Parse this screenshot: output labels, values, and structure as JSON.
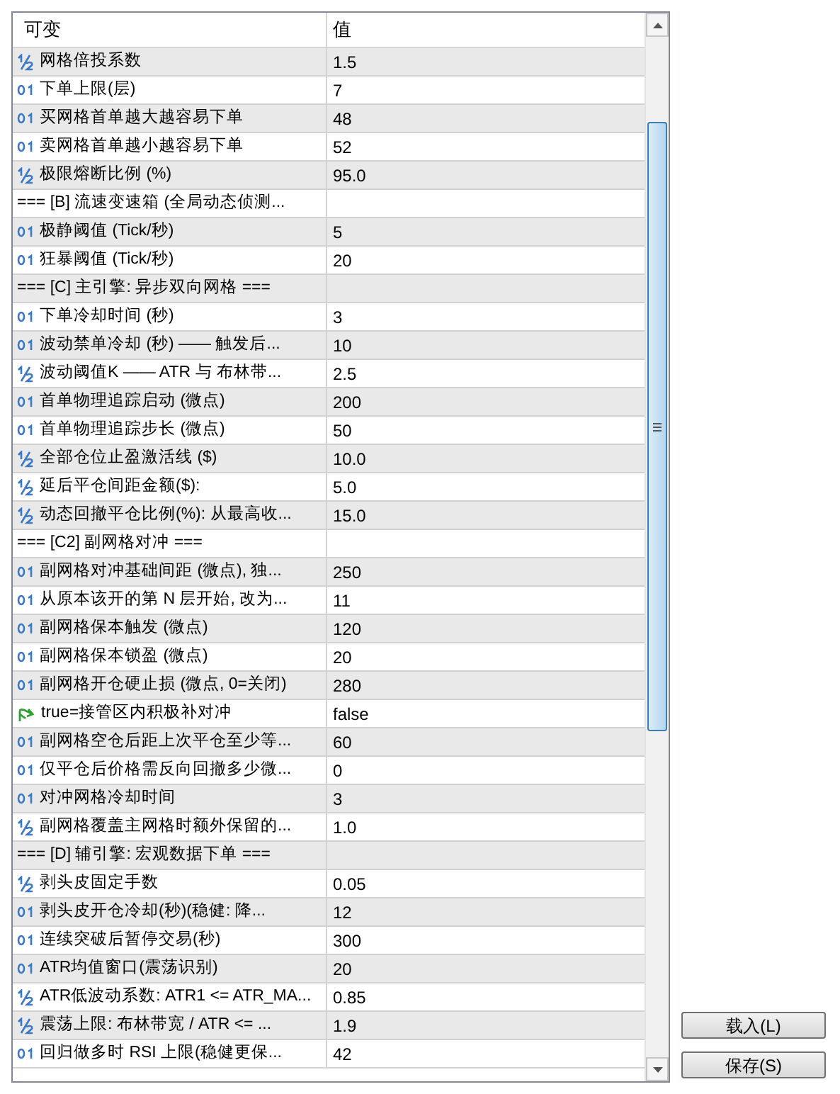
{
  "table": {
    "columns": [
      "可变",
      "值"
    ],
    "rows": [
      {
        "kind": "double",
        "name": "网格倍投系数",
        "value": "1.5"
      },
      {
        "kind": "int",
        "name": "下单上限(层)",
        "value": "7"
      },
      {
        "kind": "int",
        "name": "买网格首单越大越容易下单",
        "value": "48"
      },
      {
        "kind": "int",
        "name": "卖网格首单越小越容易下单",
        "value": "52"
      },
      {
        "kind": "double",
        "name": "极限熔断比例 (%)",
        "value": "95.0"
      },
      {
        "kind": "header",
        "name": "=== [B] 流速变速箱 (全局动态侦测..."
      },
      {
        "kind": "int",
        "name": "极静阈值 (Tick/秒)",
        "value": "5"
      },
      {
        "kind": "int",
        "name": "狂暴阈值 (Tick/秒)",
        "value": "20"
      },
      {
        "kind": "header",
        "name": "=== [C] 主引擎: 异步双向网格 ==="
      },
      {
        "kind": "int",
        "name": "下单冷却时间 (秒)",
        "value": "3"
      },
      {
        "kind": "int",
        "name": "波动禁单冷却 (秒) —— 触发后...",
        "value": "10"
      },
      {
        "kind": "double",
        "name": "波动阈值K —— ATR 与 布林带...",
        "value": "2.5"
      },
      {
        "kind": "int",
        "name": "首单物理追踪启动 (微点)",
        "value": "200"
      },
      {
        "kind": "int",
        "name": "首单物理追踪步长 (微点)",
        "value": "50"
      },
      {
        "kind": "double",
        "name": "全部仓位止盈激活线 ($)",
        "value": "10.0"
      },
      {
        "kind": "double",
        "name": "延后平仓间距金额($):",
        "value": "5.0"
      },
      {
        "kind": "double",
        "name": "动态回撤平仓比例(%): 从最高收...",
        "value": "15.0"
      },
      {
        "kind": "header",
        "name": "=== [C2] 副网格对冲 ==="
      },
      {
        "kind": "int",
        "name": "副网格对冲基础间距 (微点), 独...",
        "value": "250"
      },
      {
        "kind": "int",
        "name": "从原本该开的第 N 层开始, 改为...",
        "value": "11"
      },
      {
        "kind": "int",
        "name": "副网格保本触发 (微点)",
        "value": "120"
      },
      {
        "kind": "int",
        "name": "副网格保本锁盈 (微点)",
        "value": "20"
      },
      {
        "kind": "int",
        "name": "副网格开仓硬止损 (微点, 0=关闭)",
        "value": "280"
      },
      {
        "kind": "bool",
        "name": "true=接管区内积极补对冲",
        "value": "false"
      },
      {
        "kind": "int",
        "name": "副网格空仓后距上次平仓至少等...",
        "value": "60"
      },
      {
        "kind": "int",
        "name": "仅平仓后价格需反向回撤多少微...",
        "value": "0"
      },
      {
        "kind": "int",
        "name": "对冲网格冷却时间",
        "value": "3"
      },
      {
        "kind": "double",
        "name": "副网格覆盖主网格时额外保留的...",
        "value": "1.0"
      },
      {
        "kind": "header",
        "name": "=== [D] 辅引擎: 宏观数据下单 ==="
      },
      {
        "kind": "double",
        "name": "剥头皮固定手数",
        "value": "0.05"
      },
      {
        "kind": "int",
        "name": "剥头皮开仓冷却(秒)(稳健: 降...",
        "value": "12"
      },
      {
        "kind": "int",
        "name": "连续突破后暂停交易(秒)",
        "value": "300"
      },
      {
        "kind": "int",
        "name": "ATR均值窗口(震荡识别)",
        "value": "20"
      },
      {
        "kind": "double",
        "name": "ATR低波动系数: ATR1 <= ATR_MA...",
        "value": "0.85"
      },
      {
        "kind": "double",
        "name": "震荡上限: 布林带宽 / ATR <= ...",
        "value": "1.9"
      },
      {
        "kind": "int",
        "name": "回归做多时 RSI 上限(稳健更保...",
        "value": "42"
      }
    ]
  },
  "buttons": [
    "载入(L)",
    "保存(S)"
  ]
}
